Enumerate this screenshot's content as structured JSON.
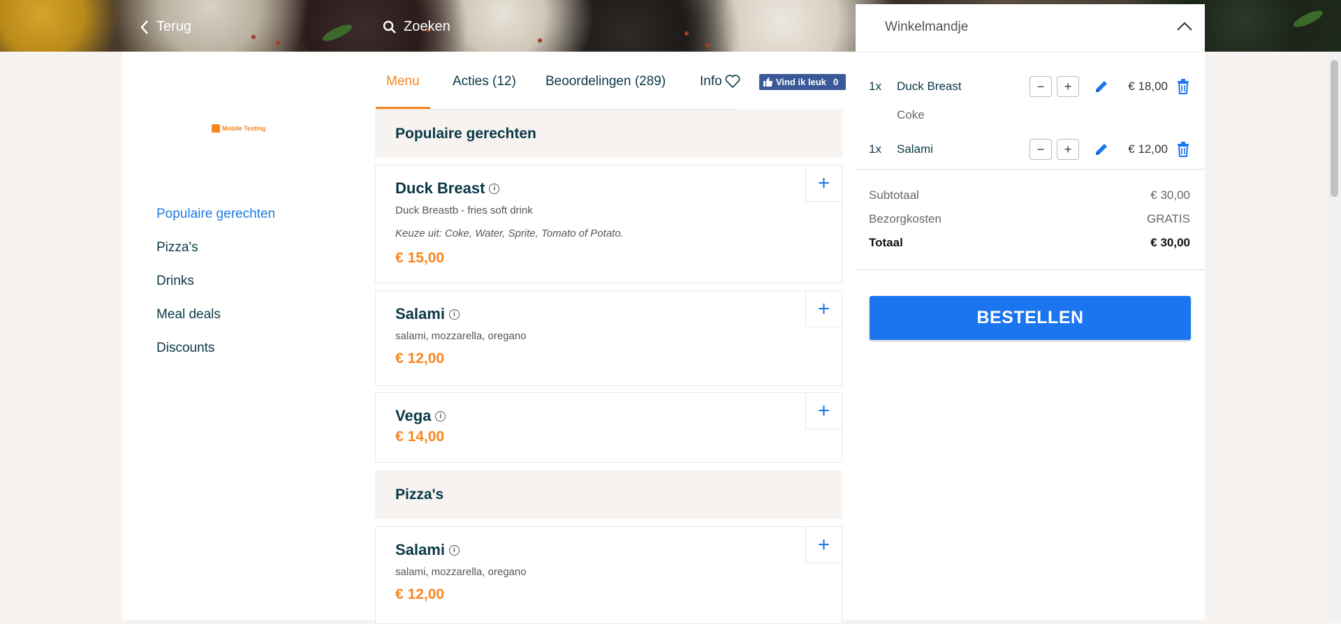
{
  "header": {
    "back_label": "Terug",
    "search_label": "Zoeken"
  },
  "restaurant": {
    "logo_text": "Mobile Testing"
  },
  "side_nav": [
    {
      "label": "Populaire gerechten",
      "active": true
    },
    {
      "label": "Pizza's"
    },
    {
      "label": "Drinks"
    },
    {
      "label": "Meal deals"
    },
    {
      "label": "Discounts"
    }
  ],
  "tabs": [
    {
      "label": "Menu",
      "active": true
    },
    {
      "label": "Acties (12)"
    },
    {
      "label": "Beoordelingen (289)"
    },
    {
      "label": "Info"
    }
  ],
  "facebook": {
    "label": "Vind ik leuk",
    "count": "0"
  },
  "menu": {
    "sections": [
      {
        "title": "Populaire gerechten",
        "dishes": [
          {
            "name": "Duck Breast",
            "description": "Duck Breastb - fries soft drink",
            "choice": "Keuze uit: Coke, Water, Sprite, Tomato of Potato.",
            "price": "€ 15,00"
          },
          {
            "name": "Salami",
            "description": "salami, mozzarella, oregano",
            "price": "€ 12,00"
          },
          {
            "name": "Vega",
            "price": "€ 14,00"
          }
        ]
      },
      {
        "title": "Pizza's",
        "dishes": [
          {
            "name": "Salami",
            "description": "salami, mozzarella, oregano",
            "price": "€ 12,00"
          }
        ]
      }
    ]
  },
  "cart": {
    "title": "Winkelmandje",
    "items": [
      {
        "qty": "1x",
        "name": "Duck Breast",
        "option": "Coke",
        "price": "€ 18,00"
      },
      {
        "qty": "1x",
        "name": "Salami",
        "price": "€ 12,00"
      }
    ],
    "minus_label": "−",
    "plus_label": "+",
    "summary": {
      "subtotal_label": "Subtotaal",
      "subtotal_value": "€ 30,00",
      "delivery_label": "Bezorgkosten",
      "delivery_value": "GRATIS",
      "total_label": "Totaal",
      "total_value": "€ 30,00"
    },
    "order_button": "BESTELLEN"
  },
  "colors": {
    "accent_orange": "#f7861e",
    "accent_blue": "#1a75ef",
    "text_dark": "#0a3847",
    "background": "#f6f3f0"
  }
}
